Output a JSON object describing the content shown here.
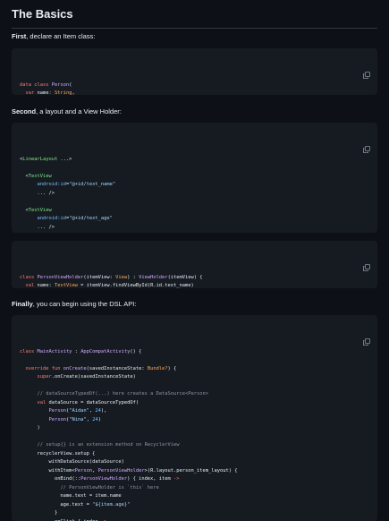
{
  "heading": "The Basics",
  "step1": {
    "bold": "First",
    "rest": ", declare an Item class:"
  },
  "step2": {
    "bold": "Second",
    "rest": ", a layout and a View Holder:"
  },
  "step3": {
    "bold": "Finally",
    "rest": ", you can begin using the DSL API:"
  },
  "copy_icon": "copy-icon",
  "blocks": {
    "person": [
      [
        [
          "kw",
          "data class "
        ],
        [
          "fn",
          "Person"
        ],
        [
          "tx",
          "("
        ]
      ],
      [
        [
          "tx",
          "  "
        ],
        [
          "kw",
          "var "
        ],
        [
          "tx",
          "name"
        ],
        [
          "kw",
          ": "
        ],
        [
          "ty",
          "String"
        ],
        [
          "tx",
          ","
        ]
      ],
      [
        [
          "tx",
          "  "
        ],
        [
          "kw",
          "var "
        ],
        [
          "tx",
          "arg"
        ],
        [
          "kw",
          ": "
        ],
        [
          "ty",
          "Int"
        ]
      ],
      [
        [
          "tx",
          ")"
        ]
      ]
    ],
    "layout": [
      [
        [
          "tx",
          "<"
        ],
        [
          "tag",
          "LinearLayout"
        ],
        [
          "tx",
          " ...>"
        ]
      ],
      [
        [
          "tx",
          ""
        ]
      ],
      [
        [
          "tx",
          "  <"
        ],
        [
          "tag",
          "TextView"
        ]
      ],
      [
        [
          "tx",
          "      "
        ],
        [
          "attr",
          "android:id"
        ],
        [
          "tx",
          "="
        ],
        [
          "str",
          "\"@+id/text_name\""
        ]
      ],
      [
        [
          "tx",
          "      ... />"
        ]
      ],
      [
        [
          "tx",
          ""
        ]
      ],
      [
        [
          "tx",
          "  <"
        ],
        [
          "tag",
          "TextView"
        ]
      ],
      [
        [
          "tx",
          "      "
        ],
        [
          "attr",
          "android:id"
        ],
        [
          "tx",
          "="
        ],
        [
          "str",
          "\"@+id/text_age\""
        ]
      ],
      [
        [
          "tx",
          "      ... />"
        ]
      ],
      [
        [
          "tx",
          ""
        ]
      ],
      [
        [
          "tx",
          "</"
        ],
        [
          "tag",
          "LinearLayout"
        ],
        [
          "tx",
          ">"
        ]
      ]
    ],
    "holder": [
      [
        [
          "kw",
          "class "
        ],
        [
          "fn",
          "PersonViewHolder"
        ],
        [
          "tx",
          "(itemView: "
        ],
        [
          "ty",
          "View"
        ],
        [
          "tx",
          ") : "
        ],
        [
          "fn",
          "ViewHolder"
        ],
        [
          "tx",
          "(itemView) {"
        ]
      ],
      [
        [
          "tx",
          "  "
        ],
        [
          "kw",
          "val "
        ],
        [
          "tx",
          "name: "
        ],
        [
          "ty",
          "TextView"
        ],
        [
          "tx",
          " = itemView.findViewById(R.id.text_name)"
        ]
      ],
      [
        [
          "tx",
          "  "
        ],
        [
          "kw",
          "val "
        ],
        [
          "tx",
          "age: "
        ],
        [
          "ty",
          "TextView"
        ],
        [
          "tx",
          " = itemView.findViewById(R.id.text_age)"
        ]
      ],
      [
        [
          "tx",
          "}"
        ]
      ]
    ],
    "dsl": [
      [
        [
          "kw",
          "class "
        ],
        [
          "fn",
          "MainActivity"
        ],
        [
          "tx",
          " : "
        ],
        [
          "fn",
          "AppCompatActivity"
        ],
        [
          "tx",
          "() {"
        ]
      ],
      [
        [
          "tx",
          ""
        ]
      ],
      [
        [
          "tx",
          "  "
        ],
        [
          "kw",
          "override fun "
        ],
        [
          "fn",
          "onCreate"
        ],
        [
          "tx",
          "(savedInstanceState: "
        ],
        [
          "ty",
          "Bundle?"
        ],
        [
          "tx",
          ") {"
        ]
      ],
      [
        [
          "tx",
          "      "
        ],
        [
          "kw",
          "super"
        ],
        [
          "tx",
          ".onCreate(savedInstanceState)"
        ]
      ],
      [
        [
          "tx",
          ""
        ]
      ],
      [
        [
          "tx",
          "      "
        ],
        [
          "cm",
          "// dataSourceTypedOf(...) here creates a DataSource<Person>"
        ]
      ],
      [
        [
          "tx",
          "      "
        ],
        [
          "kw",
          "val "
        ],
        [
          "tx",
          "dataSource = dataSourceTypedOf("
        ]
      ],
      [
        [
          "tx",
          "          "
        ],
        [
          "fn",
          "Person"
        ],
        [
          "tx",
          "("
        ],
        [
          "str",
          "\"Aidan\""
        ],
        [
          "tx",
          ", "
        ],
        [
          "attr",
          "24"
        ],
        [
          "tx",
          "),"
        ]
      ],
      [
        [
          "tx",
          "          "
        ],
        [
          "fn",
          "Person"
        ],
        [
          "tx",
          "("
        ],
        [
          "str",
          "\"Nina\""
        ],
        [
          "tx",
          ", "
        ],
        [
          "attr",
          "24"
        ],
        [
          "tx",
          ")"
        ]
      ],
      [
        [
          "tx",
          "      )"
        ]
      ],
      [
        [
          "tx",
          ""
        ]
      ],
      [
        [
          "tx",
          "      "
        ],
        [
          "cm",
          "// setup{} is an extension method on RecyclerView"
        ]
      ],
      [
        [
          "tx",
          "      recyclerView.setup {"
        ]
      ],
      [
        [
          "tx",
          "          withDataSource(dataSource)"
        ]
      ],
      [
        [
          "tx",
          "          withItem<"
        ],
        [
          "fn",
          "Person"
        ],
        [
          "tx",
          ", "
        ],
        [
          "fn",
          "PersonViewHolder"
        ],
        [
          "tx",
          ">(R.layout.person_item_layout) {"
        ]
      ],
      [
        [
          "tx",
          "            onBind(::"
        ],
        [
          "fn",
          "PersonViewHolder"
        ],
        [
          "tx",
          ") { index, item "
        ],
        [
          "kw",
          "->"
        ]
      ],
      [
        [
          "tx",
          "              "
        ],
        [
          "cm",
          "// PersonViewHolder is `this` here"
        ]
      ],
      [
        [
          "tx",
          "              name.text = item.name"
        ]
      ],
      [
        [
          "tx",
          "              age.text = "
        ],
        [
          "str",
          "\"${item.age}\""
        ]
      ],
      [
        [
          "tx",
          "            }"
        ]
      ],
      [
        [
          "tx",
          "            onClick { index "
        ],
        [
          "kw",
          "->"
        ]
      ],
      [
        [
          "tx",
          "              "
        ],
        [
          "cm",
          "// item is a `val` in `this` here"
        ]
      ]
    ]
  }
}
